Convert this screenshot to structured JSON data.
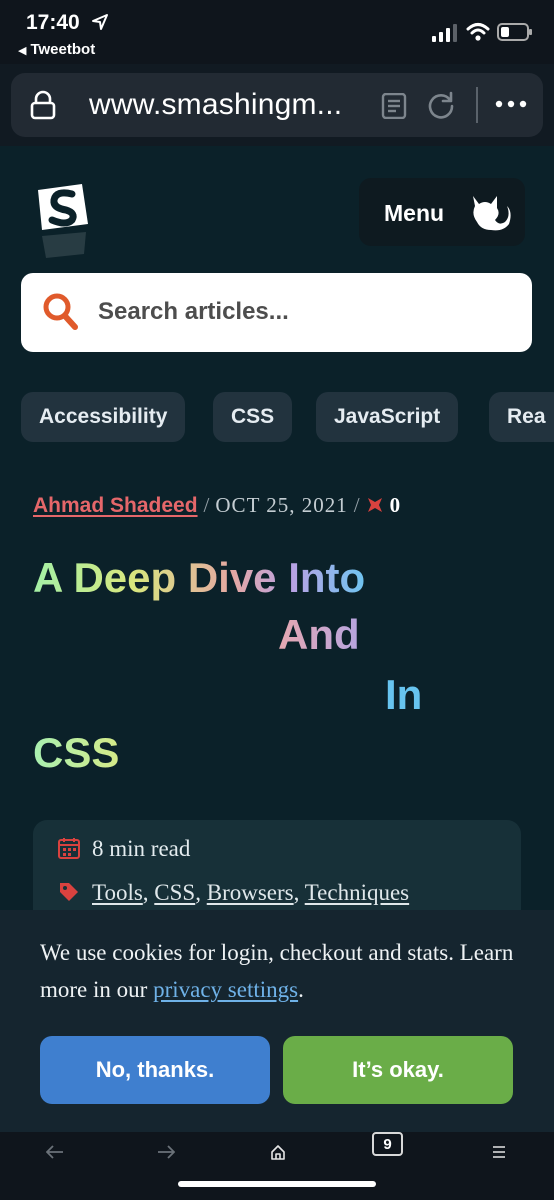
{
  "status_bar": {
    "time": "17:40",
    "back_app": "Tweetbot"
  },
  "browser": {
    "url": "www.smashingm...",
    "icons": [
      "lock-icon",
      "reader-icon",
      "reload-icon",
      "more-icon"
    ]
  },
  "header": {
    "menu_label": "Menu",
    "search_placeholder": "Search articles..."
  },
  "tags": [
    {
      "label": "Accessibility"
    },
    {
      "label": "CSS"
    },
    {
      "label": "JavaScript"
    },
    {
      "label": "Rea"
    }
  ],
  "article": {
    "author": "Ahmad Shadeed",
    "date": "OCT 25, 2021",
    "comment_count": "0",
    "title_parts": [
      "A Deep Dive Into",
      "And",
      "In",
      "CSS"
    ],
    "read_time": "8 min read",
    "categories": [
      "Tools",
      "CSS",
      "Browsers",
      "Techniques"
    ]
  },
  "cookie_banner": {
    "text": "We use cookies for login, checkout and stats. Learn more in our",
    "link": "privacy settings",
    "period": ".",
    "decline_label": "No, thanks.",
    "accept_label": "It’s okay."
  },
  "toolbar": {
    "tab_count": "9"
  },
  "colors": {
    "page_bg": "#0b2129",
    "accent_red": "#e5676a",
    "decline_blue": "#3f7fcf",
    "accept_green": "#6aad48"
  }
}
